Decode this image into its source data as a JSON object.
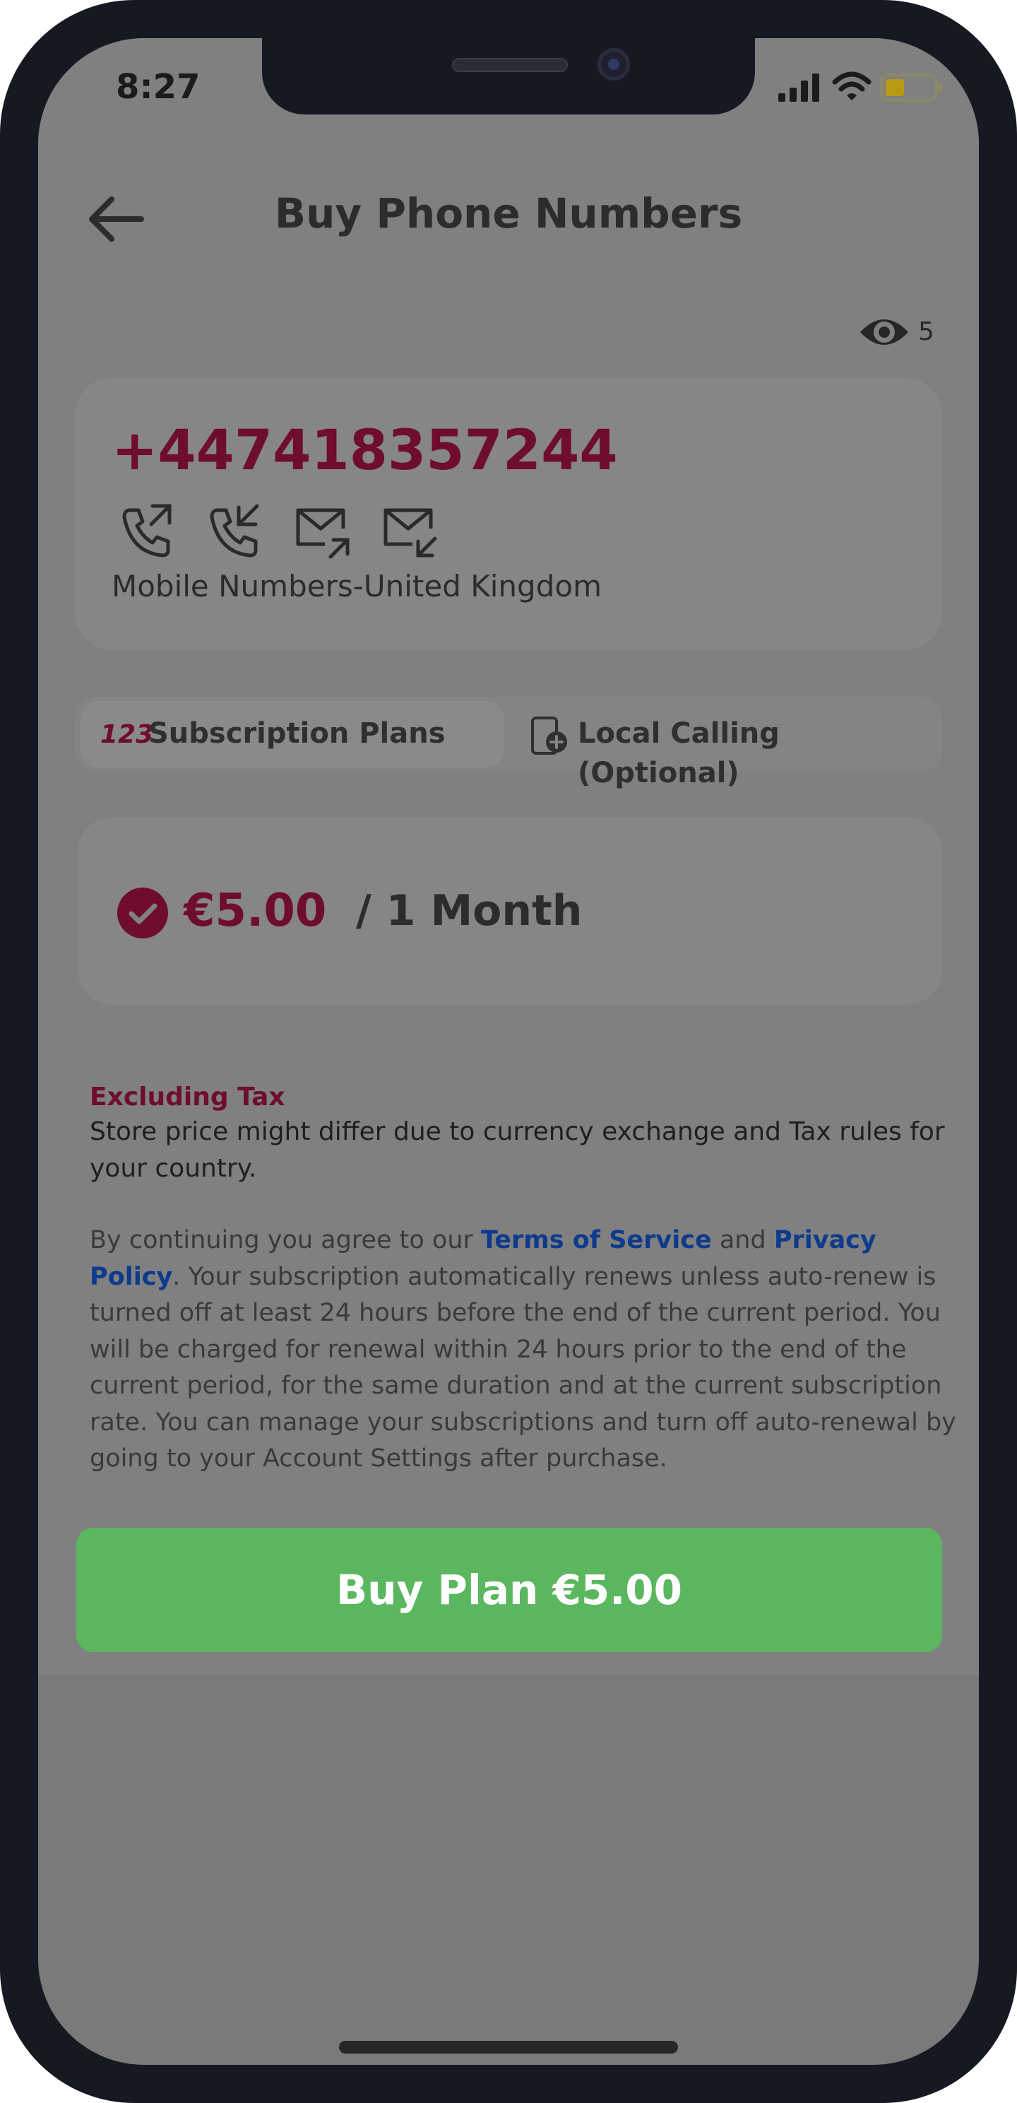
{
  "status_bar": {
    "time": "8:27",
    "icons": [
      "signal-icon",
      "wifi-icon",
      "battery-icon"
    ]
  },
  "header": {
    "back_icon": "arrow-left-icon",
    "title": "Buy Phone Numbers"
  },
  "view_counter": {
    "icon": "eye-icon",
    "count": "5"
  },
  "number_card": {
    "phone_number": "+447418357244",
    "capabilities": [
      "outgoing-call-icon",
      "incoming-call-icon",
      "outgoing-sms-icon",
      "incoming-sms-icon"
    ],
    "type_label": "Mobile Numbers-United Kingdom"
  },
  "tabs": [
    {
      "icon": "numbers-123-icon",
      "icon_text": "123",
      "label": "Subscription Plans",
      "selected": true
    },
    {
      "icon": "phone-add-icon",
      "label": "Local Calling (Optional)",
      "selected": false
    }
  ],
  "plan": {
    "selected": true,
    "price": "€5.00",
    "period": "/ 1 Month"
  },
  "tax": {
    "title": "Excluding Tax",
    "note": "Store price might differ due to currency exchange and Tax rules for your country."
  },
  "legal": {
    "prefix": "By continuing you agree to our ",
    "terms_link": "Terms of Service",
    "and": " and ",
    "privacy_link": "Privacy Policy",
    "body": ". Your subscription automatically renews unless auto-renew is turned off at least 24 hours before the end of the current period. You will be charged for renewal within 24 hours prior to the end of the current period, for the same duration and at the current subscription rate. You can manage your subscriptions and turn off auto-renewal by going to your Account Settings after purchase."
  },
  "buy_button": {
    "label": "Buy Plan €5.00"
  },
  "colors": {
    "accent": "#6e0d2c",
    "button_green": "#5bb75f",
    "link_blue": "#0d3a8c"
  }
}
